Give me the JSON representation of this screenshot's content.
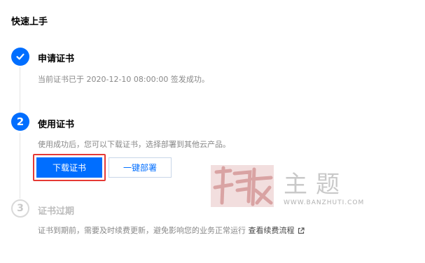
{
  "page": {
    "title": "快速上手"
  },
  "steps": [
    {
      "number": "1",
      "status": "done",
      "title": "申请证书",
      "desc": "当前证书已于 2020-12-10 08:00:00 签发成功。"
    },
    {
      "number": "2",
      "status": "active",
      "title": "使用证书",
      "desc": "使用成功后，您可以下载证书，选择部署到其他云产品。"
    },
    {
      "number": "3",
      "status": "pending",
      "title": "证书过期",
      "desc": "证书到期前，需要及时续费更新，避免影响您的业务正常运行",
      "link": "查看续费流程"
    }
  ],
  "buttons": {
    "download": "下载证书",
    "deploy": "一键部署"
  },
  "icons": {
    "done": "check-icon",
    "external": "external-link-icon"
  },
  "colors": {
    "primary": "#006eff",
    "highlight": "#e53935"
  },
  "watermark": {
    "text": "主题",
    "url": "WWW.BANZHUTI.COM"
  }
}
